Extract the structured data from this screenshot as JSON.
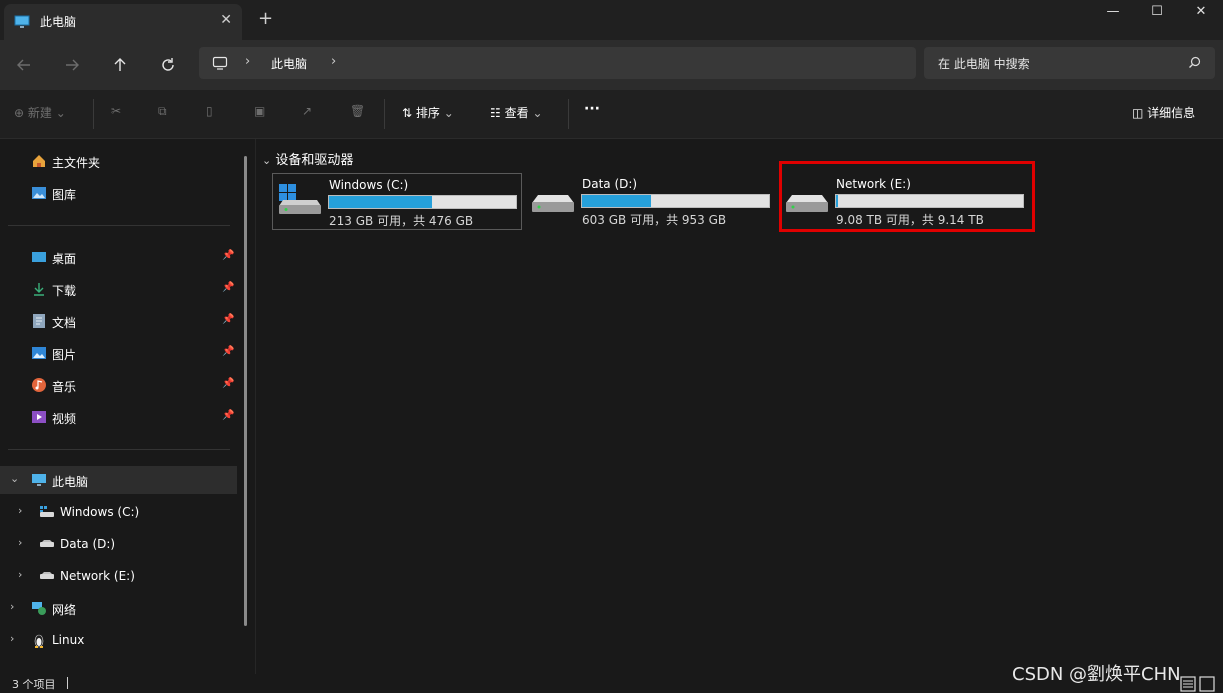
{
  "window": {
    "tab_title": "此电脑",
    "close_tab": "✕",
    "new_tab": "+",
    "minimize": "—",
    "maximize": "☐",
    "close": "✕"
  },
  "address": {
    "root_crumb": "此电脑",
    "search_placeholder": "在 此电脑 中搜索"
  },
  "toolbar": {
    "new_label": "新建",
    "sort_label": "排序",
    "view_label": "查看",
    "more_label": "···",
    "details_label": "详细信息"
  },
  "sidebar": {
    "home": "主文件夹",
    "gallery": "图库",
    "desktop": "桌面",
    "downloads": "下载",
    "documents": "文档",
    "pictures": "图片",
    "music": "音乐",
    "videos": "视频",
    "this_pc": "此电脑",
    "drive_c": "Windows (C:)",
    "drive_d": "Data (D:)",
    "drive_e": "Network (E:)",
    "network": "网络",
    "linux": "Linux"
  },
  "main": {
    "section_title": "设备和驱动器",
    "drives": [
      {
        "name": "Windows (C:)",
        "size_text": "213 GB 可用，共 476 GB",
        "used_fraction": 0.553
      },
      {
        "name": "Data (D:)",
        "size_text": "603 GB 可用，共 953 GB",
        "used_fraction": 0.367
      },
      {
        "name": "Network (E:)",
        "size_text": "9.08 TB 可用，共 9.14 TB",
        "used_fraction": 0.007
      }
    ]
  },
  "status": {
    "item_count": "3 个项目"
  },
  "watermark": "CSDN @劉焕平CHN",
  "colors": {
    "accent": "#26a0da",
    "highlight": "#e00000"
  }
}
